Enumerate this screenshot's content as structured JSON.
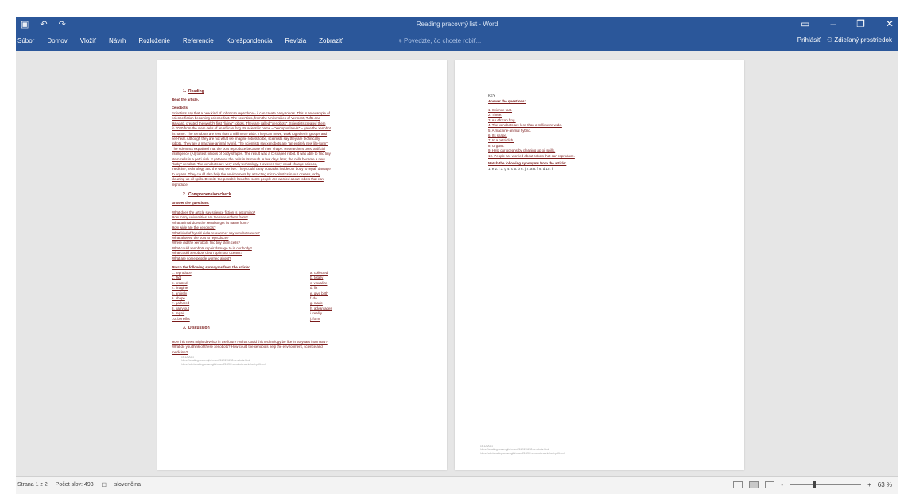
{
  "app": {
    "title": "Reading pracovný list - Word",
    "qat_icons": [
      "save-icon",
      "undo-icon",
      "redo-icon"
    ],
    "window_controls": [
      "ribbon-display-icon",
      "minimize-icon",
      "restore-icon",
      "close-icon"
    ],
    "accent_color": "#2b579a"
  },
  "ribbon": {
    "tabs": [
      "Súbor",
      "Domov",
      "Vložiť",
      "Návrh",
      "Rozloženie",
      "Referencie",
      "Korešpondencia",
      "Revízia",
      "Zobraziť"
    ],
    "tell_me_placeholder": "Povedzte, čo chcete robiť...",
    "signin": "Prihlásiť",
    "share": "Zdieľaný prostriedok"
  },
  "page1": {
    "s1_number": "1.",
    "s1_title": "Reading",
    "s1_instruction": "Read the article.",
    "article_title": "Xenobots",
    "article_lines": [
      "Scientists say that a new kind of robot can reproduce - it can create baby robots. This is an example of",
      "science fiction becoming science fact. The scientists, from the Universities of Vermont, Tufts and",
      "Harvard, created the world's first \"living\" robots. They are called \"xenobots\". Scientists created them",
      "in 2020 from the stem cells of an African frog. Its scientific name – \"xenopus laevis\" – gave the xenobot",
      "its name. The xenobots are less than a millimetre wide. They can move, work together in groups and",
      "self-heal. Although they are not what we imagine robots to be, scientists say they are technically",
      "robots. They are a machine-animal hybrid. The scientists say xenobots are \"an entirely new life-form\".",
      "The scientists explained that the bots reproduce because of their shape. Researchers used artificial",
      "intelligence (AI) to test billions of body shapes. The result was a C-shaped robot. It was able to find tiny",
      "stem cells in a petri dish. It gathered the cells in its mouth. A few days later, the cells became a new",
      "\"baby\" xenobot. The xenobots are very early technology. However, they could change science,",
      "medicine, technology and the way we live. They could carry out tasks inside our body to repair damage",
      "to organs. They could also help the environment by attracting micro-plastics in our oceans, or by",
      "cleaning up oil spills. Despite the possible benefits, some people are worried about robots that can",
      "reproduce."
    ],
    "s2_number": "2.",
    "s2_title": "Comprehension check",
    "s2_instruction": "Answer the questions:",
    "questions": [
      "What does the article say science fiction is becoming?",
      "How many universities are the researchers from?",
      "What animal does the xenobot get its name from?",
      "How wide are the xenobots?",
      "What kind of hybrid did a researcher say xenobots were?",
      "What allowed the bots to reproduce?",
      "Where did the xenobots find tiny stem cells?",
      "What could xenobots repair damage to in our body?",
      "What could xenobots clean up in our oceans?",
      "What are some people worried about?"
    ],
    "match_title": "Match the following synonyms from the article:",
    "match_left": [
      "1. reproduce",
      "2. fact",
      "3. created",
      "4. imagine",
      "5. entirely",
      "6. shape",
      "7. gathered",
      "8. carry out",
      "9. repair",
      "10. benefits"
    ],
    "match_right": [
      "a. collected",
      "b. totally",
      "c. visualize",
      "d. fix",
      "e. give birth",
      "f. do",
      "g. made",
      "h. advantages",
      "i. reality",
      "j. form"
    ],
    "s3_number": "3.",
    "s3_title": "Discussion",
    "discussion_lines": [
      "How this news might develop in the future? What could this technology be like in 50 years from now?",
      "What do you think of these xenobots? How could the xenobots help the environment, science and",
      "medicine?"
    ],
    "footer_lines": [
      "15.12.2021",
      "https://breakingnewsenglish.com/2112/211202-xenobots.html",
      "https://cdn.breakingnewsenglish.com/211202-xenobots-worksheet-pdf.html"
    ]
  },
  "page2": {
    "key_label": "KEY",
    "answers_title": "Answer the questions:",
    "answers": [
      "1. Science fact.",
      "2. Three.",
      "3. An African frog.",
      "4. The xenobots are less than a millimetre wide.",
      "5. A machine-animal hybrid.",
      "6. Its shape.",
      "7. In a petri dish.",
      "8. Organs.",
      "9. Help our oceans by cleaning up oil spills.",
      "10. People are worried about robots that can reproduce."
    ],
    "match_title": "Match the following synonyms from the article:",
    "match_answers": "1. e 2. i 3. g 4. c 5. b 6. j 7. a 8. f 9. d 10. h",
    "footer_lines": [
      "15.12.2021",
      "https://breakingnewsenglish.com/2112/211202-xenobots.html",
      "https://cdn.breakingnewsenglish.com/211202-xenobots-worksheet-pdf.html"
    ]
  },
  "status": {
    "page": "Strana 1 z 2",
    "words": "Počet slov: 493",
    "language": "slovenčina",
    "zoom": "63 %",
    "zoom_minus": "-",
    "zoom_plus": "+",
    "zoom_level": 0.33
  }
}
